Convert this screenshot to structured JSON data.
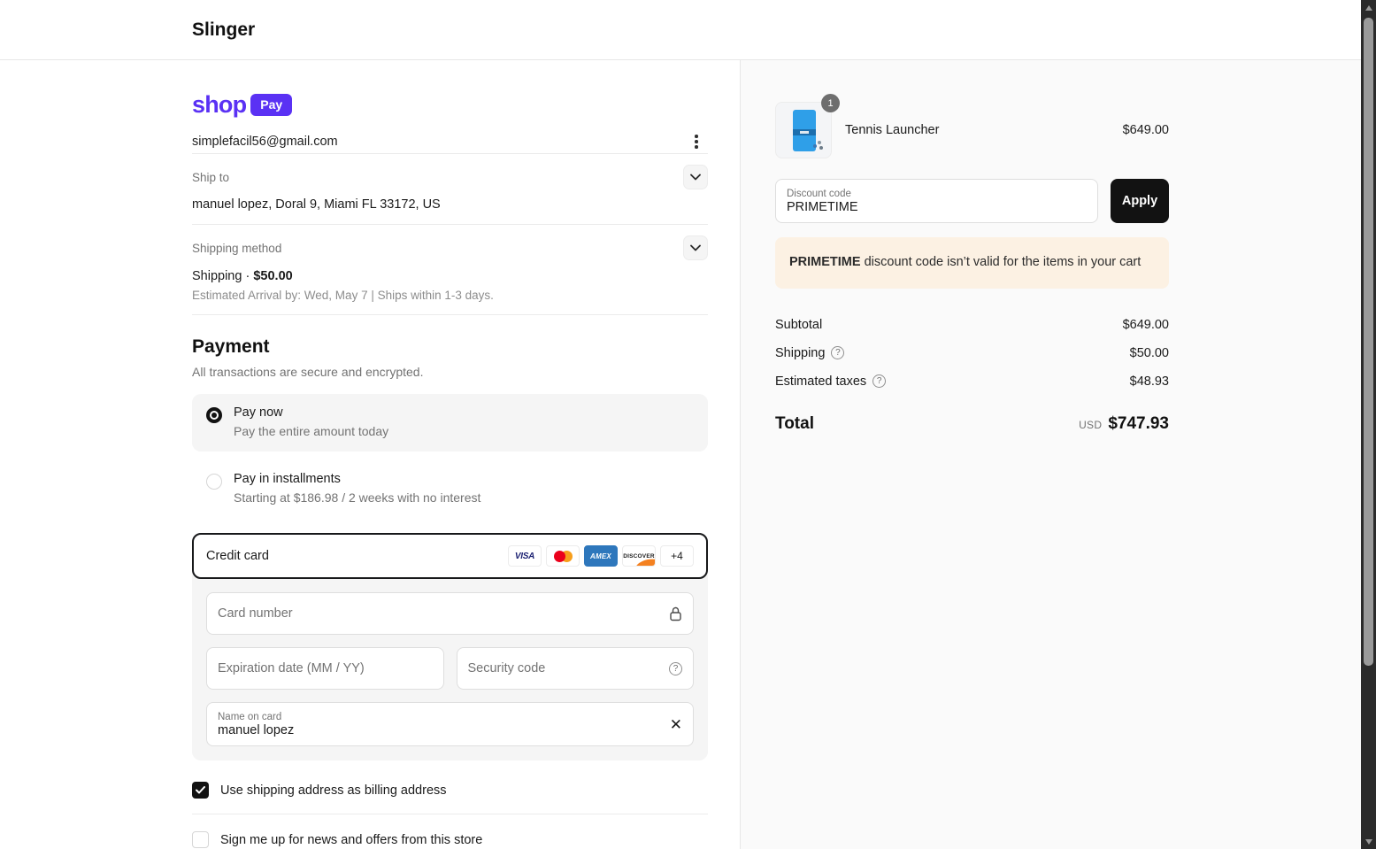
{
  "header": {
    "store_name": "Slinger"
  },
  "shop_pay": {
    "shop": "shop",
    "pay": "Pay"
  },
  "account": {
    "email": "simplefacil56@gmail.com"
  },
  "ship_to": {
    "label": "Ship to",
    "value": "manuel lopez, Doral 9, Miami FL 33172, US"
  },
  "shipping_method": {
    "label": "Shipping method",
    "name": "Shipping",
    "separator": "·",
    "price": "$50.00",
    "estimate": "Estimated Arrival by: Wed, May 7 | Ships within 1-3 days."
  },
  "payment": {
    "title": "Payment",
    "subtitle": "All transactions are secure and encrypted.",
    "options": [
      {
        "label": "Pay now",
        "description": "Pay the entire amount today",
        "selected": true
      },
      {
        "label": "Pay in installments",
        "description": "Starting at $186.98 / 2 weeks with no interest",
        "selected": false
      }
    ],
    "credit_card": {
      "label": "Credit card",
      "brands": {
        "visa": "VISA",
        "amex": "AMEX",
        "discover": "DISCOVER",
        "more": "+4"
      },
      "card_number_placeholder": "Card number",
      "expiration_placeholder": "Expiration date (MM / YY)",
      "security_placeholder": "Security code",
      "name_label": "Name on card",
      "name_value": "manuel lopez"
    },
    "billing_checkbox_label": "Use shipping address as billing address",
    "newsletter_checkbox_label": "Sign me up for news and offers from this store"
  },
  "summary": {
    "item": {
      "name": "Tennis Launcher",
      "quantity": "1",
      "price": "$649.00"
    },
    "discount": {
      "label": "Discount code",
      "value": "PRIMETIME",
      "apply_label": "Apply",
      "error_code": "PRIMETIME",
      "error_rest": " discount code isn’t valid for the items in your cart"
    },
    "totals": [
      {
        "label": "Subtotal",
        "value": "$649.00"
      },
      {
        "label": "Shipping",
        "value": "$50.00"
      },
      {
        "label": "Estimated taxes",
        "value": "$48.93"
      }
    ],
    "total": {
      "label": "Total",
      "currency": "USD",
      "value": "$747.93"
    }
  },
  "icons": {
    "help": "?",
    "clear": "✕"
  },
  "colors": {
    "accent_purple": "#5a31f4",
    "button_black": "#121212",
    "warning_bg": "#fcf1e3",
    "right_panel_bg": "#fafafa"
  }
}
